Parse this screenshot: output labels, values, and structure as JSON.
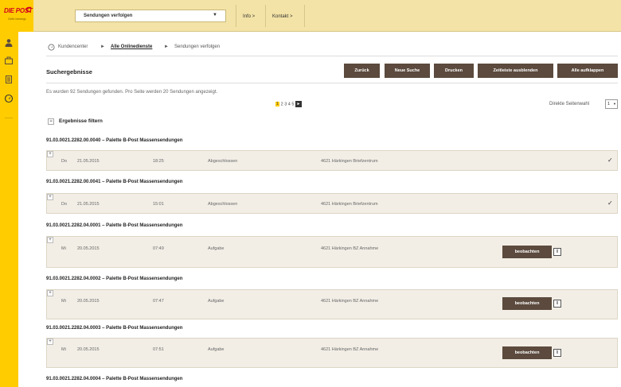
{
  "brand": {
    "name": "DIE POST",
    "tagline": "Gelb bewegt."
  },
  "top": {
    "select_value": "Sendungen verfolgen",
    "links": [
      "Info >",
      "Kontakt >"
    ]
  },
  "breadcrumb": [
    "Kundencenter",
    "Alle Onlinedienste",
    "Sendungen verfolgen"
  ],
  "page_title": "Suchergebnisse",
  "buttons": [
    "Zurück",
    "Neue Suche",
    "Drucken",
    "Zeitleiste ausblenden",
    "Alle aufklappen"
  ],
  "found_text": "Es wurden 92 Sendungen gefunden. Pro Seite werden 20 Sendungen angezeigt.",
  "pagination": {
    "pages": [
      "1",
      "2",
      "3",
      "4",
      "5"
    ],
    "current": "1"
  },
  "direct_page": {
    "label": "Direkte Seitenwahl",
    "value": "1"
  },
  "filter_label": "Ergebnisse filtern",
  "groups": [
    {
      "title": "91.03.0021.2282.00.0040 – Palette B-Post Massensendungen",
      "day": "Do",
      "date": "21.05.2015",
      "time": "18:25",
      "status": "Abgeschlossen",
      "location": "4621 Härkingen Briefzentrum",
      "action": ""
    },
    {
      "title": "91.03.0021.2282.00.0041 – Palette B-Post Massensendungen",
      "day": "Do",
      "date": "21.05.2015",
      "time": "15:01",
      "status": "Abgeschlossen",
      "location": "4621 Härkingen Briefzentrum",
      "action": ""
    },
    {
      "title": "91.03.0021.2282.04.0001 – Palette B-Post Massensendungen",
      "day": "Mi",
      "date": "20.05.2015",
      "time": "07:49",
      "status": "Aufgabe",
      "location": "4621 Härkingen BZ Annahme",
      "action": "beobachten"
    },
    {
      "title": "91.03.0021.2282.04.0002 – Palette B-Post Massensendungen",
      "day": "Mi",
      "date": "20.05.2015",
      "time": "07:47",
      "status": "Aufgabe",
      "location": "4621 Härkingen BZ Annahme",
      "action": "beobachten"
    },
    {
      "title": "91.03.0021.2282.04.0003 – Palette B-Post Massensendungen",
      "day": "Mi",
      "date": "20.05.2015",
      "time": "07:51",
      "status": "Aufgabe",
      "location": "4621 Härkingen BZ Annahme",
      "action": "beobachten"
    },
    {
      "title": "91.03.0021.2282.04.0004 – Palette B-Post Massensendungen"
    }
  ],
  "colors": {
    "yellow": "#ffcc00",
    "brown": "#5b4a3d",
    "red": "#d2001e"
  }
}
